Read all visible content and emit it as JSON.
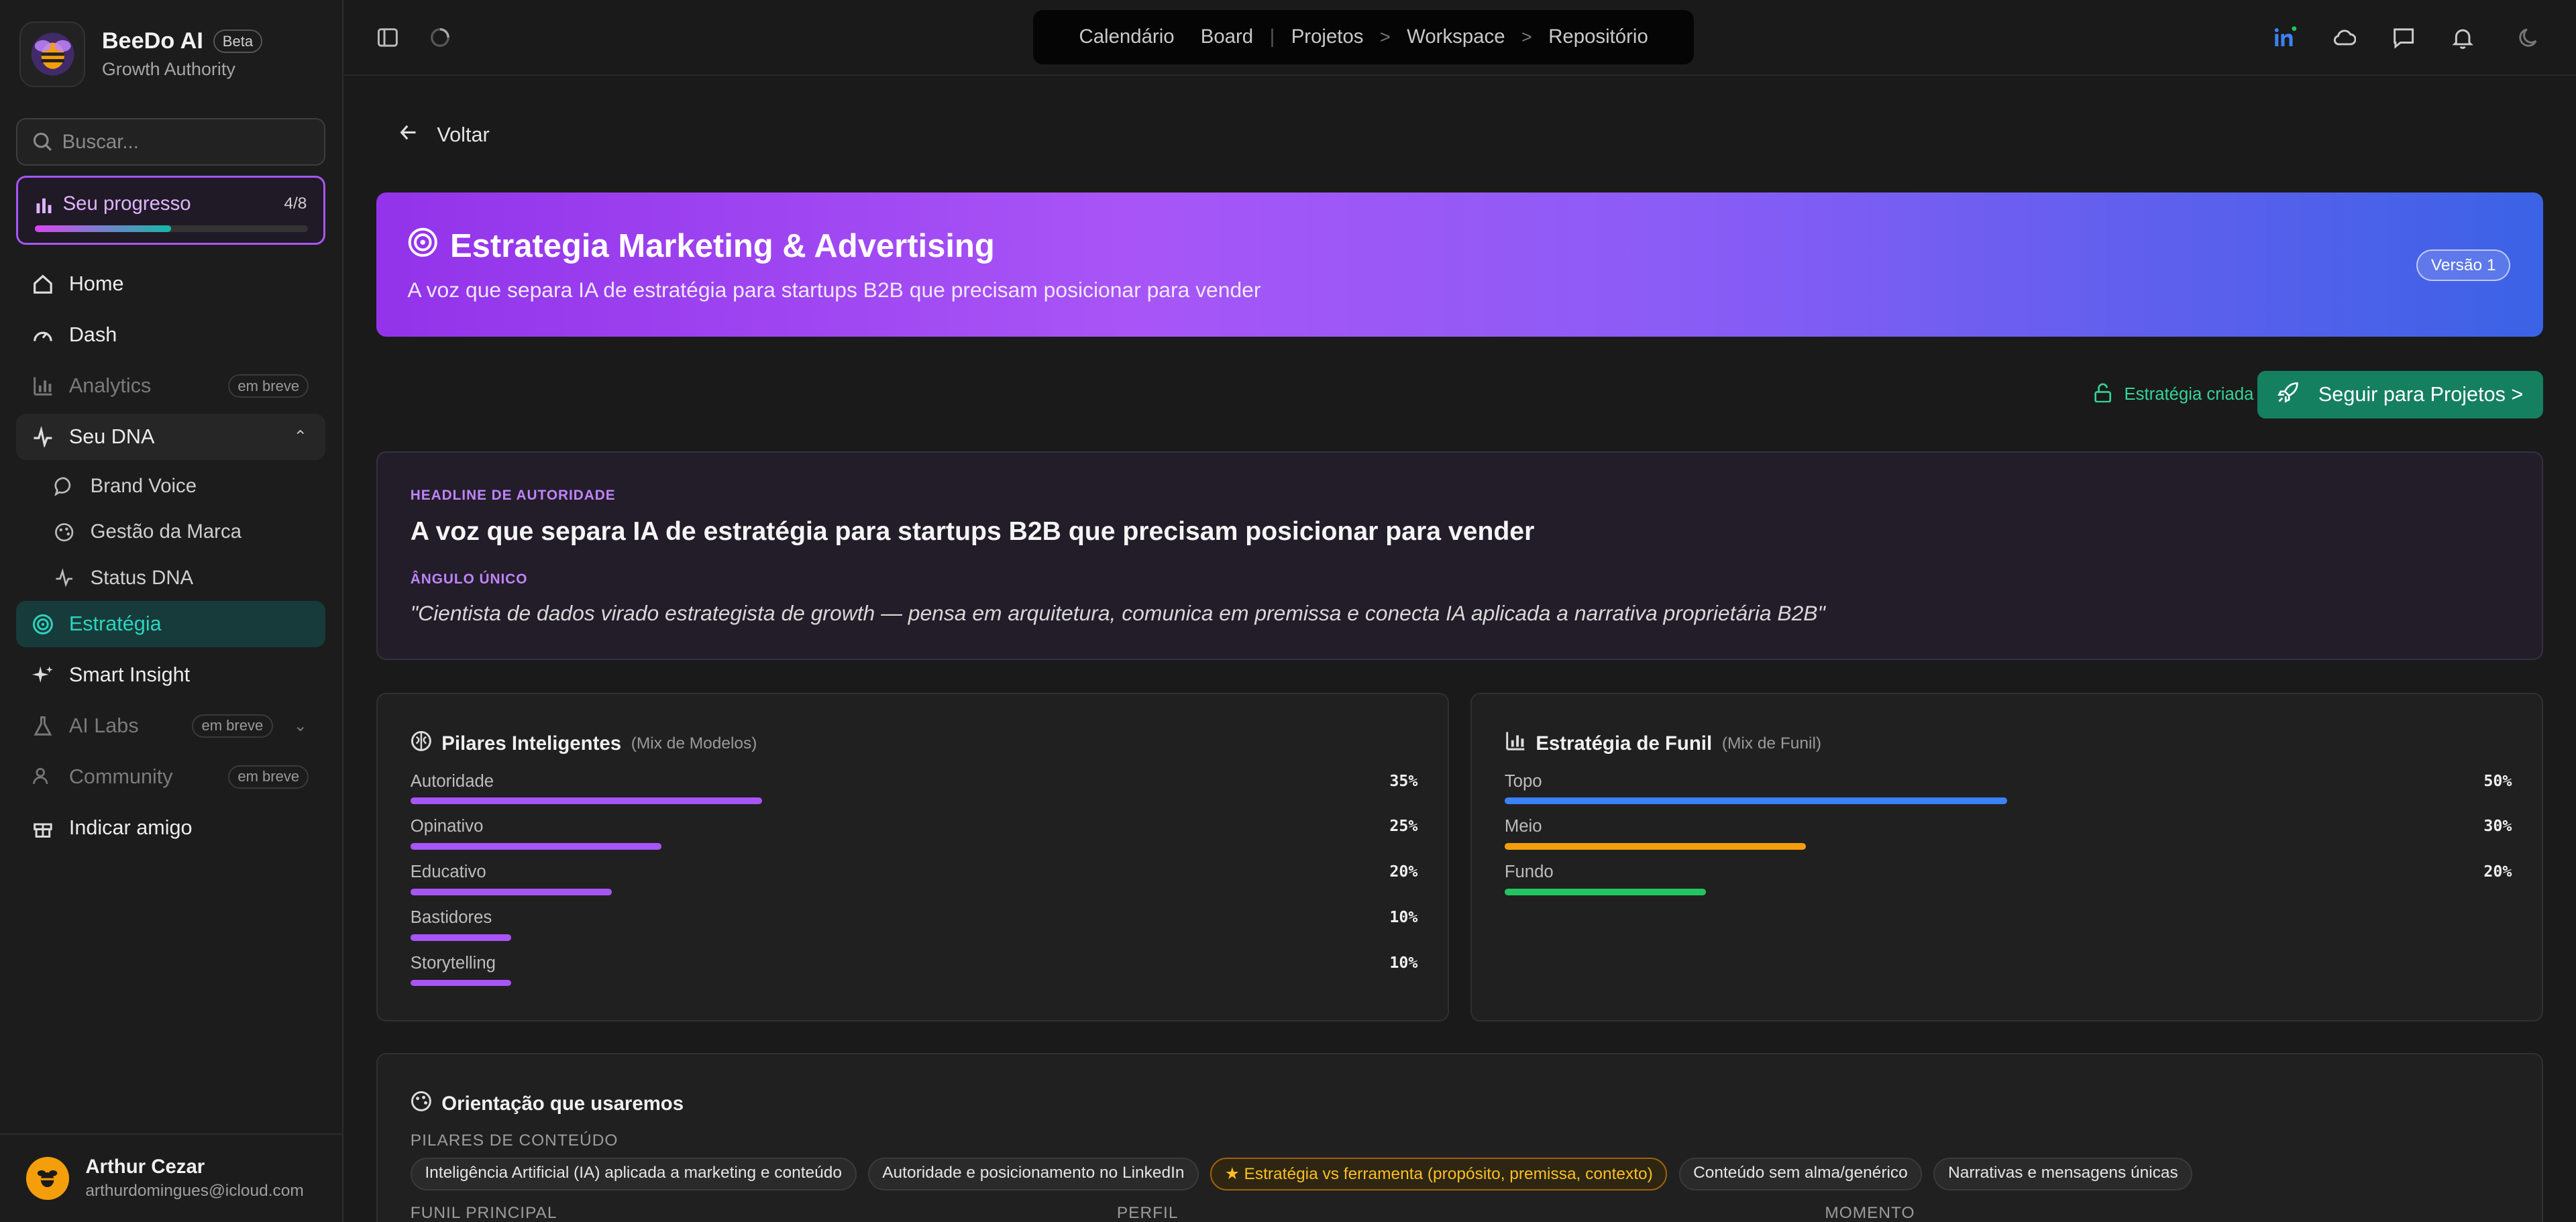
{
  "app": {
    "name": "BeeDo AI",
    "badge": "Beta",
    "subtitle": "Growth Authority"
  },
  "sidebar": {
    "search_placeholder": "Buscar...",
    "progress": {
      "label": "Seu progresso",
      "count": "4/8",
      "fraction": 0.5
    },
    "items": [
      {
        "label": "Home"
      },
      {
        "label": "Dash"
      },
      {
        "label": "Analytics",
        "soon": "em breve"
      },
      {
        "label": "Seu DNA"
      },
      {
        "label": "Brand Voice"
      },
      {
        "label": "Gestão da Marca"
      },
      {
        "label": "Status DNA"
      },
      {
        "label": "Estratégia"
      },
      {
        "label": "Smart Insight"
      },
      {
        "label": "AI Labs",
        "soon": "em breve"
      },
      {
        "label": "Community",
        "soon": "em breve"
      },
      {
        "label": "Indicar amigo"
      }
    ],
    "user": {
      "name": "Arthur Cezar",
      "email": "arthurdomingues@icloud.com"
    }
  },
  "topnav": {
    "items": [
      "Calendário",
      "Board",
      "Projetos",
      "Workspace",
      "Repositório"
    ],
    "separator": "|",
    "arrow": ">"
  },
  "main": {
    "back_label": "Voltar",
    "hero": {
      "title": "Estrategia Marketing & Advertising",
      "subtitle": "A voz que separa IA de estratégia para startups B2B que precisam posicionar para vender",
      "version": "Versão 1"
    },
    "status_label": "Estratégia criada",
    "cta_label": "Seguir para Projetos >",
    "headline": {
      "label": "HEADLINE DE AUTORIDADE",
      "text": "A voz que separa IA de estratégia para startups B2B que precisam posicionar para vender",
      "angle_label": "ÂNGULO ÚNICO",
      "angle_text": "\"Cientista de dados virado estrategista de growth — pensa em arquitetura, comunica em premissa e conecta IA aplicada a narrativa proprietária B2B\""
    },
    "pillars": {
      "title": "Pilares Inteligentes",
      "mix": "(Mix de Modelos)",
      "rows": [
        {
          "name": "Autoridade",
          "pct": "35%",
          "value": 0.35
        },
        {
          "name": "Opinativo",
          "pct": "25%",
          "value": 0.25
        },
        {
          "name": "Educativo",
          "pct": "20%",
          "value": 0.2
        },
        {
          "name": "Bastidores",
          "pct": "10%",
          "value": 0.1
        },
        {
          "name": "Storytelling",
          "pct": "10%",
          "value": 0.1
        }
      ],
      "color": "#a855f7"
    },
    "funnel": {
      "title": "Estratégia de Funil",
      "mix": "(Mix de Funil)",
      "rows": [
        {
          "name": "Topo",
          "pct": "50%",
          "value": 0.5,
          "color": "#3b82f6"
        },
        {
          "name": "Meio",
          "pct": "30%",
          "value": 0.3,
          "color": "#f59e0b"
        },
        {
          "name": "Fundo",
          "pct": "20%",
          "value": 0.2,
          "color": "#22c55e"
        }
      ]
    },
    "orientation": {
      "title": "Orientação que usaremos",
      "pillars_label": "PILARES DE CONTEÚDO",
      "chips": [
        "Inteligência Artificial (IA) aplicada a marketing e conteúdo",
        "Autoridade e posicionamento no LinkedIn",
        "★ Estratégia vs ferramenta (propósito, premissa, contexto)",
        "Conteúdo sem alma/genérico",
        "Narrativas e mensagens únicas"
      ],
      "funnel_label": "FUNIL PRINCIPAL",
      "profile_label": "PERFIL",
      "moment_label": "MOMENTO"
    }
  }
}
